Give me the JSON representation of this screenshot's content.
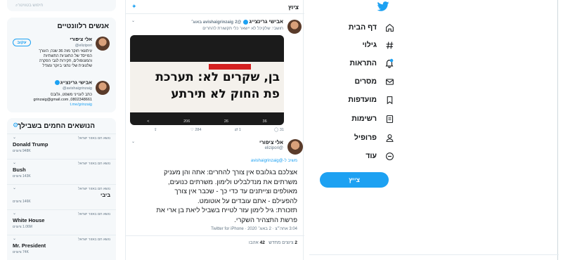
{
  "nav": {
    "items": [
      {
        "label": "דף הבית",
        "icon": "home-icon"
      },
      {
        "label": "גילוי",
        "icon": "hashtag-icon"
      },
      {
        "label": "התראות",
        "icon": "bell-icon"
      },
      {
        "label": "מסרים",
        "icon": "mail-icon"
      },
      {
        "label": "מועדפות",
        "icon": "bookmark-icon"
      },
      {
        "label": "רשימות",
        "icon": "list-icon"
      },
      {
        "label": "פרופיל",
        "icon": "profile-icon"
      },
      {
        "label": "עוד",
        "icon": "more-icon"
      }
    ],
    "tweet_button": "צייץ"
  },
  "header": {
    "title": "ציוץ"
  },
  "quoted_tweet": {
    "name": "אבישי גרינצייג",
    "handle": "@avishaigrinzaig",
    "time": "2 באוג׳",
    "text": "חושבי: שלקיכל לא יישאר כלי תקשורת להחרים",
    "headline_1": "בן, שקרים לא: תערכת",
    "headline_2": "פת החוק לא תירתע",
    "media_stats": [
      "206",
      "26",
      "36"
    ],
    "actions": [
      "284",
      "1",
      "31"
    ]
  },
  "main_tweet": {
    "name": "אלי ציפורי",
    "handle": "@elizipori",
    "reply_to": "משיב ל-@avishaigrinzaig",
    "lines": [
      "אצלכם בגלובס אין צורך להחרים: אתה והן מעניק",
      "משרתים את מנדלבליט ולימון. משרתים כנועים,",
      "מאולפים וצייתנים עד כדי כך - שכבר אין צורך",
      "להפעילם - אתם עובדים על אוטומט.",
      "תזכורת: גיל לימון עזר לטייח בשביל ליאת בן ארי את",
      "פרשת התצהיר השקרי."
    ],
    "meta": "3:04 אחה״צ · 2 באוג׳ 2020 · Twitter for iPhone",
    "retweets_count": "2",
    "retweets_label": "ציוצים מחדש",
    "likes_count": "42",
    "likes_label": "אהבו"
  },
  "sidebar": {
    "search_placeholder": "חיפוש בטוויטר",
    "relevant_title": "אנשים רלוונטיים",
    "people": [
      {
        "name": "אלי ציפורי",
        "handle": "@elizipori",
        "bio": [
          "עיתונאי חוקר מזה 36 שנה; העורך",
          "המייסד של התעניות התשתיות",
          "והמונופולים, חקירות לגבי הפקרה",
          "שלטונית שלי נתוני ביוקר ומגדל"
        ],
        "follow": "עקוב"
      },
      {
        "name": "אבישי גרינצייג",
        "handle": "@avishaigrinzaig",
        "bio": [
          "כתב לענייני משפט, גלובס",
          "grinzaig@gmail.com ,0802348661",
          "t.me/grinzaig"
        ]
      }
    ],
    "trends_title": "הנושאים החמים בשבילך",
    "trends": [
      {
        "context": "נושא חם באזור ישראל",
        "name": "Donald Trump",
        "count": "948K ציוצים"
      },
      {
        "context": "נושא חם באזור ישראל",
        "name": "Bush",
        "count": "143K ציוצים"
      },
      {
        "context": "נושא חם באזור ישראל",
        "name": "ביבי",
        "count": "146K ציוצים"
      },
      {
        "context": "נושא חם באזור ישראל",
        "name": "White House",
        "count": "1.06M ציוצים"
      },
      {
        "context": "נושא חם באזור ישראל",
        "name": "Mr. President",
        "count": "74K ציוצים"
      }
    ]
  },
  "colors": {
    "accent": "#1da1f2",
    "text": "#14171a",
    "muted": "#657786",
    "panel": "#f5f8fa"
  }
}
